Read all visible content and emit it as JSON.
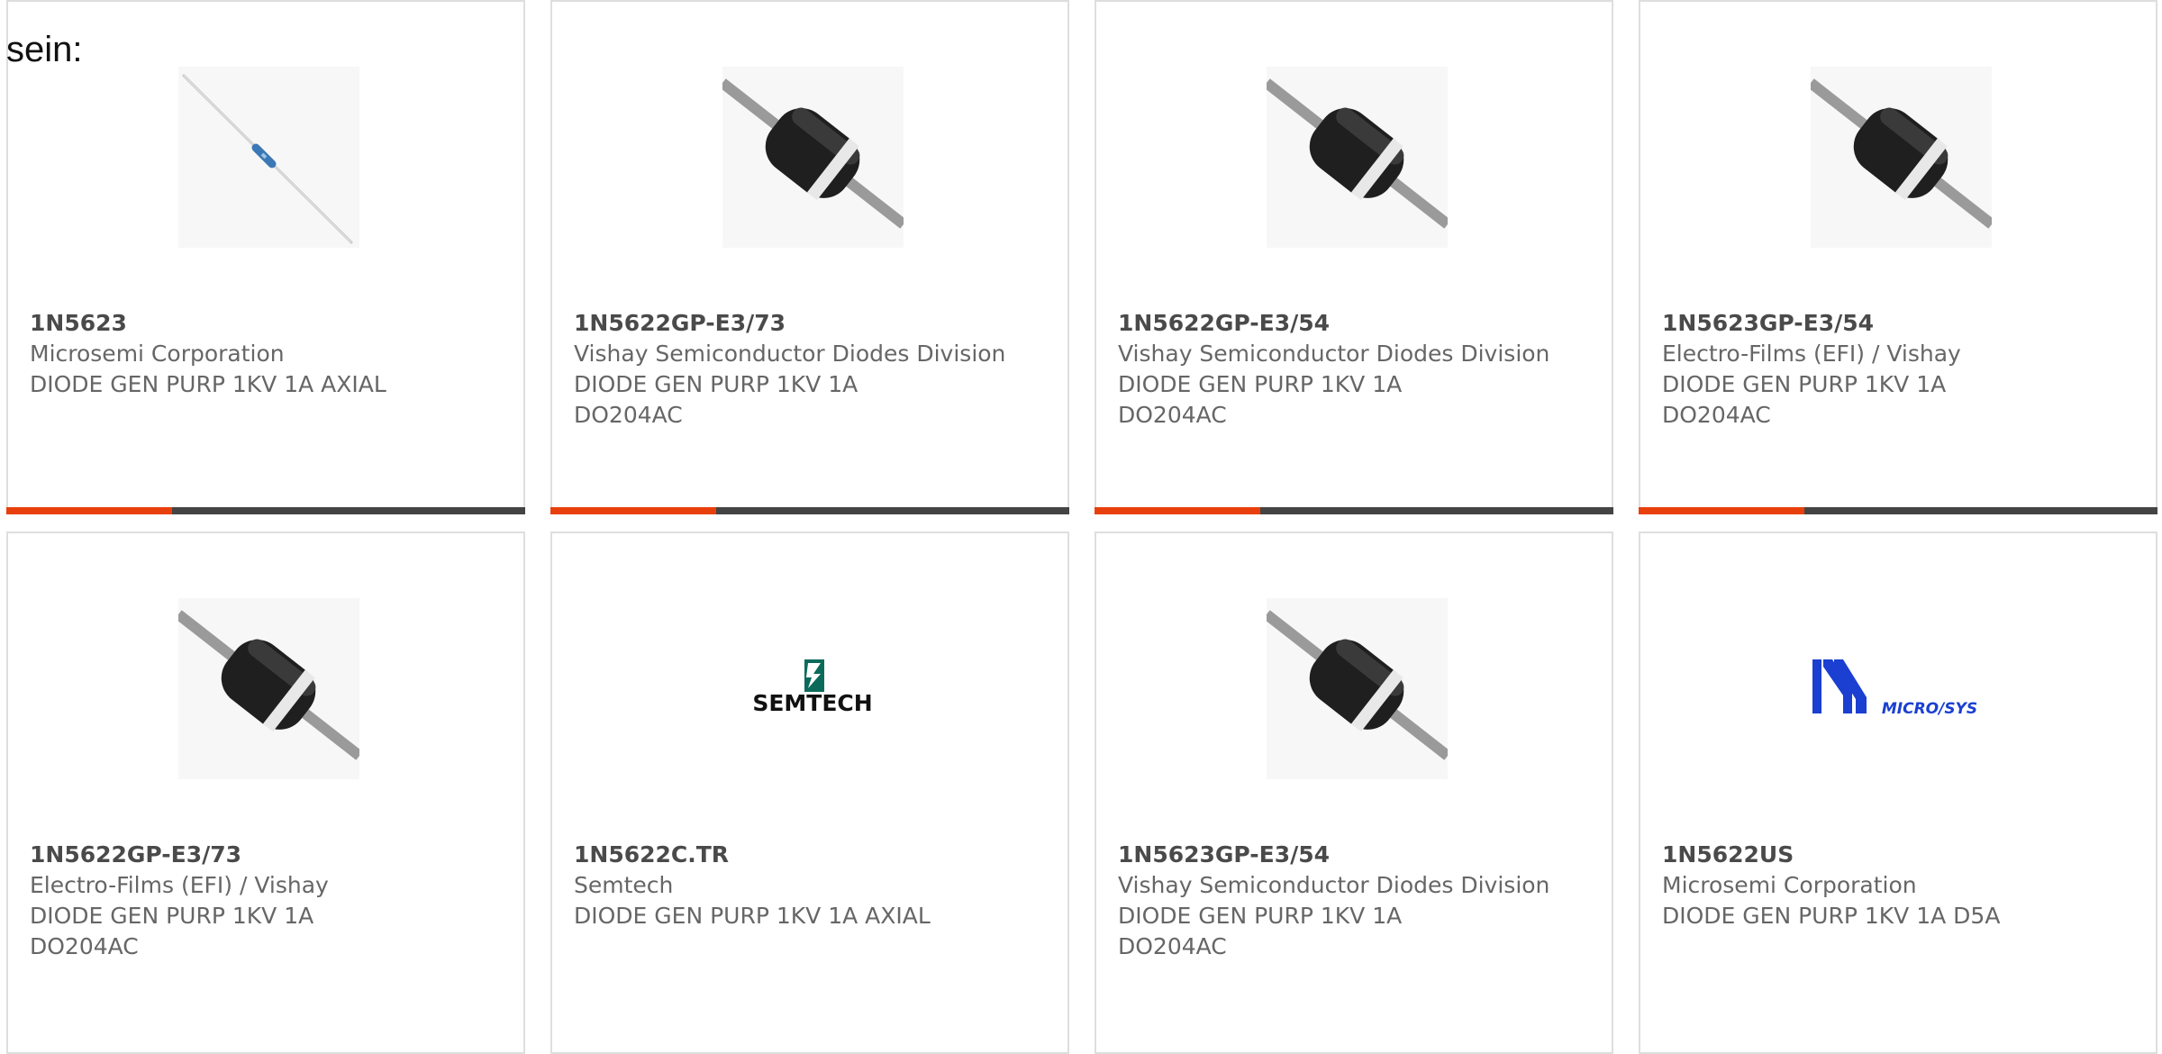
{
  "intro_text": "sein:",
  "colors": {
    "accent": "#e8400c",
    "bar": "#444444",
    "card_border": "#dedede"
  },
  "products": [
    {
      "part_number": "1N5623",
      "manufacturer": "Microsemi Corporation",
      "description": "DIODE GEN PURP 1KV 1A AXIAL",
      "image": "thin-axial-diode-icon",
      "accent_fraction": 0.32
    },
    {
      "part_number": "1N5622GP-E3/73",
      "manufacturer": "Vishay Semiconductor Diodes Division",
      "description": "DIODE GEN PURP 1KV 1A DO204AC",
      "image": "black-axial-diode-icon",
      "accent_fraction": 0.32
    },
    {
      "part_number": "1N5622GP-E3/54",
      "manufacturer": "Vishay Semiconductor Diodes Division",
      "description": "DIODE GEN PURP 1KV 1A DO204AC",
      "image": "black-axial-diode-icon",
      "accent_fraction": 0.32
    },
    {
      "part_number": "1N5623GP-E3/54",
      "manufacturer": "Electro-Films (EFI) / Vishay",
      "description": "DIODE GEN PURP 1KV 1A DO204AC",
      "image": "black-axial-diode-icon",
      "accent_fraction": 0.32
    },
    {
      "part_number": "1N5622GP-E3/73",
      "manufacturer": "Electro-Films (EFI) / Vishay",
      "description": "DIODE GEN PURP 1KV 1A DO204AC",
      "image": "black-axial-diode-icon"
    },
    {
      "part_number": "1N5622C.TR",
      "manufacturer": "Semtech",
      "description": "DIODE GEN PURP 1KV 1A AXIAL",
      "image": "semtech-logo",
      "logo_text": "SEMTECH"
    },
    {
      "part_number": "1N5623GP-E3/54",
      "manufacturer": "Vishay Semiconductor Diodes Division",
      "description": "DIODE GEN PURP 1KV 1A DO204AC",
      "image": "black-axial-diode-icon"
    },
    {
      "part_number": "1N5622US",
      "manufacturer": "Microsemi Corporation",
      "description": "DIODE GEN PURP 1KV 1A D5A",
      "image": "microsys-logo",
      "logo_text": "MICRO/SYS"
    }
  ]
}
